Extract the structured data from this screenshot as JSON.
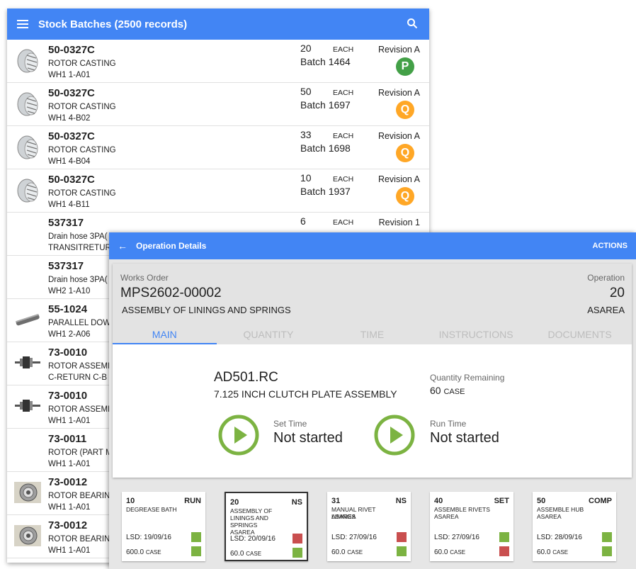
{
  "colors": {
    "accent": "#4285f4",
    "status_p": "#43a047",
    "status_q": "#ffa726",
    "play": "#7cb342",
    "ok": "#7cb342",
    "bad": "#c94f4f"
  },
  "stock": {
    "title": "Stock Batches (2500 records)",
    "rows": [
      {
        "code": "50-0327C",
        "desc": "ROTOR CASTING",
        "loc": "WH1  1-A01",
        "qty": "20",
        "unit": "EACH",
        "batch": "Batch 1464",
        "rev": "Revision A",
        "status": "P",
        "icon": "rotor-casting-image"
      },
      {
        "code": "50-0327C",
        "desc": "ROTOR CASTING",
        "loc": "WH1  4-B02",
        "qty": "50",
        "unit": "EACH",
        "batch": "Batch 1697",
        "rev": "Revision A",
        "status": "Q",
        "icon": "rotor-casting-image"
      },
      {
        "code": "50-0327C",
        "desc": "ROTOR CASTING",
        "loc": "WH1  4-B04",
        "qty": "33",
        "unit": "EACH",
        "batch": "Batch 1698",
        "rev": "Revision A",
        "status": "Q",
        "icon": "rotor-casting-image"
      },
      {
        "code": "50-0327C",
        "desc": "ROTOR CASTING",
        "loc": "WH1  4-B11",
        "qty": "10",
        "unit": "EACH",
        "batch": "Batch 1937",
        "rev": "Revision A",
        "status": "Q",
        "icon": "rotor-casting-image"
      },
      {
        "code": "537317",
        "desc": "Drain hose 3PA(",
        "loc": "TRANSITRETURI",
        "qty": "6",
        "unit": "EACH",
        "batch": "",
        "rev": "Revision 1",
        "status": "",
        "icon": ""
      },
      {
        "code": "537317",
        "desc": "Drain hose 3PA(",
        "loc": "WH2  1-A10",
        "qty": "",
        "unit": "",
        "batch": "",
        "rev": "",
        "status": "",
        "icon": ""
      },
      {
        "code": "55-1024",
        "desc": "PARALLEL DOW",
        "loc": "WH1  2-A06",
        "qty": "",
        "unit": "",
        "batch": "",
        "rev": "",
        "status": "",
        "icon": "dowel-pin-image"
      },
      {
        "code": "73-0010",
        "desc": "ROTOR ASSEME",
        "loc": "C-RETURN  C-B",
        "qty": "",
        "unit": "",
        "batch": "",
        "rev": "",
        "status": "",
        "icon": "rotor-assembly-image"
      },
      {
        "code": "73-0010",
        "desc": "ROTOR ASSEME",
        "loc": "WH1  1-A01",
        "qty": "",
        "unit": "",
        "batch": "",
        "rev": "",
        "status": "",
        "icon": "rotor-assembly-image"
      },
      {
        "code": "73-0011",
        "desc": "ROTOR (PART M",
        "loc": "WH1  1-A01",
        "qty": "",
        "unit": "",
        "batch": "",
        "rev": "",
        "status": "",
        "icon": ""
      },
      {
        "code": "73-0012",
        "desc": "ROTOR BEARIN(",
        "loc": "WH1  1-A01",
        "qty": "",
        "unit": "",
        "batch": "",
        "rev": "",
        "status": "",
        "icon": "bearing-image"
      },
      {
        "code": "73-0012",
        "desc": "ROTOR BEARIN(",
        "loc": "WH1  1-A01",
        "qty": "",
        "unit": "",
        "batch": "",
        "rev": "",
        "status": "",
        "icon": "bearing-image"
      }
    ]
  },
  "op": {
    "title": "Operation Details",
    "actions": "ACTIONS",
    "works_order_label": "Works Order",
    "works_order": "MPS2602-00002",
    "works_order_desc": "ASSEMBLY OF LININGS AND SPRINGS",
    "operation_label": "Operation",
    "operation": "20",
    "area": "ASAREA",
    "tabs": [
      "MAIN",
      "QUANTITY",
      "TIME",
      "INSTRUCTIONS",
      "DOCUMENTS"
    ],
    "part_code": "AD501.RC",
    "part_desc": "7.125 INCH CLUTCH PLATE ASSEMBLY",
    "qty_rem_label": "Quantity Remaining",
    "qty_rem": "60",
    "qty_rem_unit": "CASE",
    "set_time_label": "Set Time",
    "set_time": "Not started",
    "run_time_label": "Run Time",
    "run_time": "Not started",
    "cards": [
      {
        "num": "10",
        "status": "RUN",
        "desc": "DEGREASE BATH",
        "area": "",
        "lsd": "LSD: 19/09/16",
        "qty": "600.0",
        "unit": "CASE",
        "flags": [
          "ok",
          "ok"
        ]
      },
      {
        "num": "20",
        "status": "NS",
        "desc": "ASSEMBLY OF LININGS AND SPRINGS",
        "area": "ASAREA",
        "lsd": "LSD: 20/09/16",
        "qty": "60.0",
        "unit": "CASE",
        "flags": [
          "bad",
          "ok"
        ]
      },
      {
        "num": "31",
        "status": "NS",
        "desc": "MANUAL RIVET LININGS",
        "area": "ASAREA",
        "lsd": "LSD: 27/09/16",
        "qty": "60.0",
        "unit": "CASE",
        "flags": [
          "bad",
          "ok"
        ]
      },
      {
        "num": "40",
        "status": "SET",
        "desc": "ASSEMBLE RIVETS",
        "area": "ASAREA",
        "lsd": "LSD: 27/09/16",
        "qty": "60.0",
        "unit": "CASE",
        "flags": [
          "ok",
          "bad"
        ]
      },
      {
        "num": "50",
        "status": "COMP",
        "desc": "ASSEMBLE HUB",
        "area": "ASAREA",
        "lsd": "LSD: 28/09/16",
        "qty": "60.0",
        "unit": "CASE",
        "flags": [
          "ok",
          "ok"
        ]
      }
    ]
  }
}
